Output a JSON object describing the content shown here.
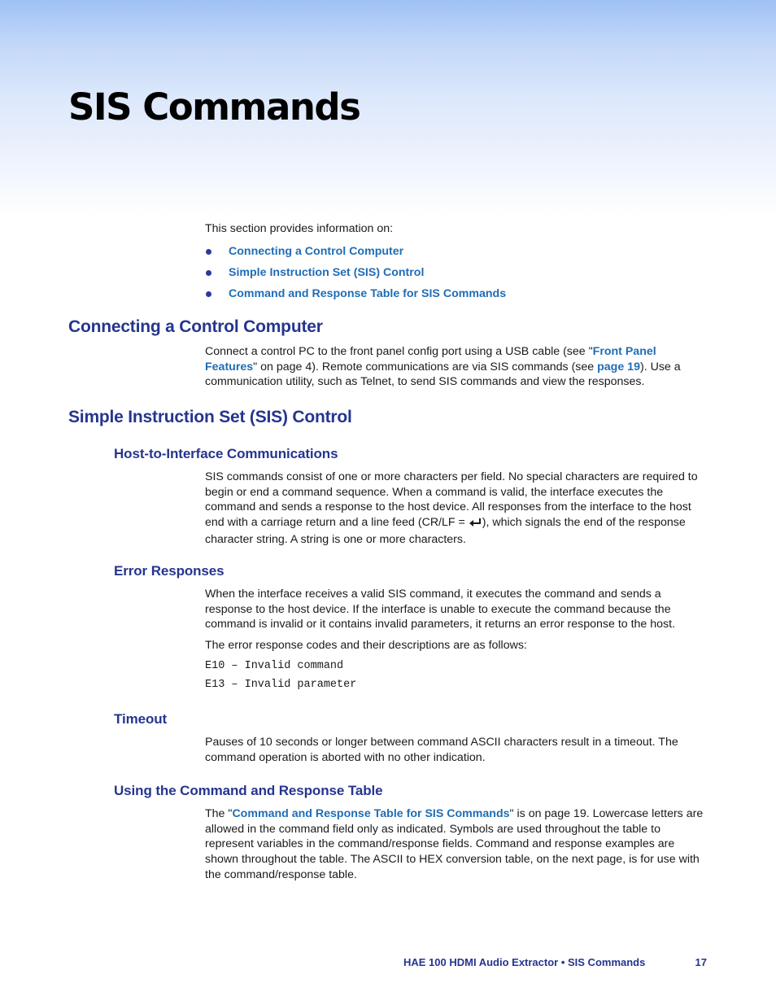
{
  "header": {
    "title": "SIS Commands"
  },
  "intro": {
    "text": "This section provides information on:",
    "toc": [
      {
        "label": "Connecting a Control Computer"
      },
      {
        "label": "Simple Instruction Set (SIS) Control"
      },
      {
        "label": "Command and Response Table for SIS Commands"
      }
    ]
  },
  "sections": {
    "connecting": {
      "heading": "Connecting a Control Computer",
      "p1_a": "Connect a control PC to the front panel config port using a USB cable (see \"",
      "p1_link1": "Front Panel Features",
      "p1_b": "\" on page 4). Remote communications are via SIS commands (see ",
      "p1_link2": "page 19",
      "p1_c": "). Use a communication utility, such as Telnet, to send SIS commands and view the responses."
    },
    "sis_control": {
      "heading": "Simple Instruction Set (SIS) Control",
      "host": {
        "heading": "Host-to-Interface Communications",
        "p1_a": "SIS commands consist of one or more characters per field. No special characters are required to begin or end a command sequence. When a command is valid, the interface executes the command and sends a response to the host device. All responses from the interface to the host end with a carriage return and a line feed (CR/LF = ",
        "p1_icon": "enter-arrow-icon",
        "p1_b": "), which signals the end of the response character string. A string is one or more characters."
      },
      "errors": {
        "heading": "Error Responses",
        "p1": "When the interface receives a valid SIS command, it executes the command and sends a response to the host device. If the interface is unable to execute the command because the command is invalid or it contains invalid parameters, it returns an error response to the host.",
        "p2": "The error response codes and their descriptions are as follows:",
        "codes": [
          {
            "text": "E10 – Invalid command"
          },
          {
            "text": "E13 – Invalid parameter"
          }
        ]
      },
      "timeout": {
        "heading": "Timeout",
        "p1": "Pauses of 10 seconds or longer between command ASCII characters result in a timeout. The command operation is aborted with no other indication."
      },
      "using_table": {
        "heading": "Using the Command and Response Table",
        "p1_a": "The \"",
        "p1_link": "Command and Response Table for SIS Commands",
        "p1_b": "\" is on page 19. Lowercase letters are allowed in the command field only as indicated. Symbols are used throughout the table to represent variables in the command/response fields. Command and response examples are shown throughout the table. The ASCII to HEX conversion table, on the next page, is for use with the command/response table."
      }
    }
  },
  "footer": {
    "doc_title": "HAE 100 HDMI Audio Extractor • SIS Commands",
    "page_number": "17"
  },
  "colors": {
    "heading": "#25358f",
    "link": "#1f6db5",
    "banner_top": "#9fc1f5"
  }
}
